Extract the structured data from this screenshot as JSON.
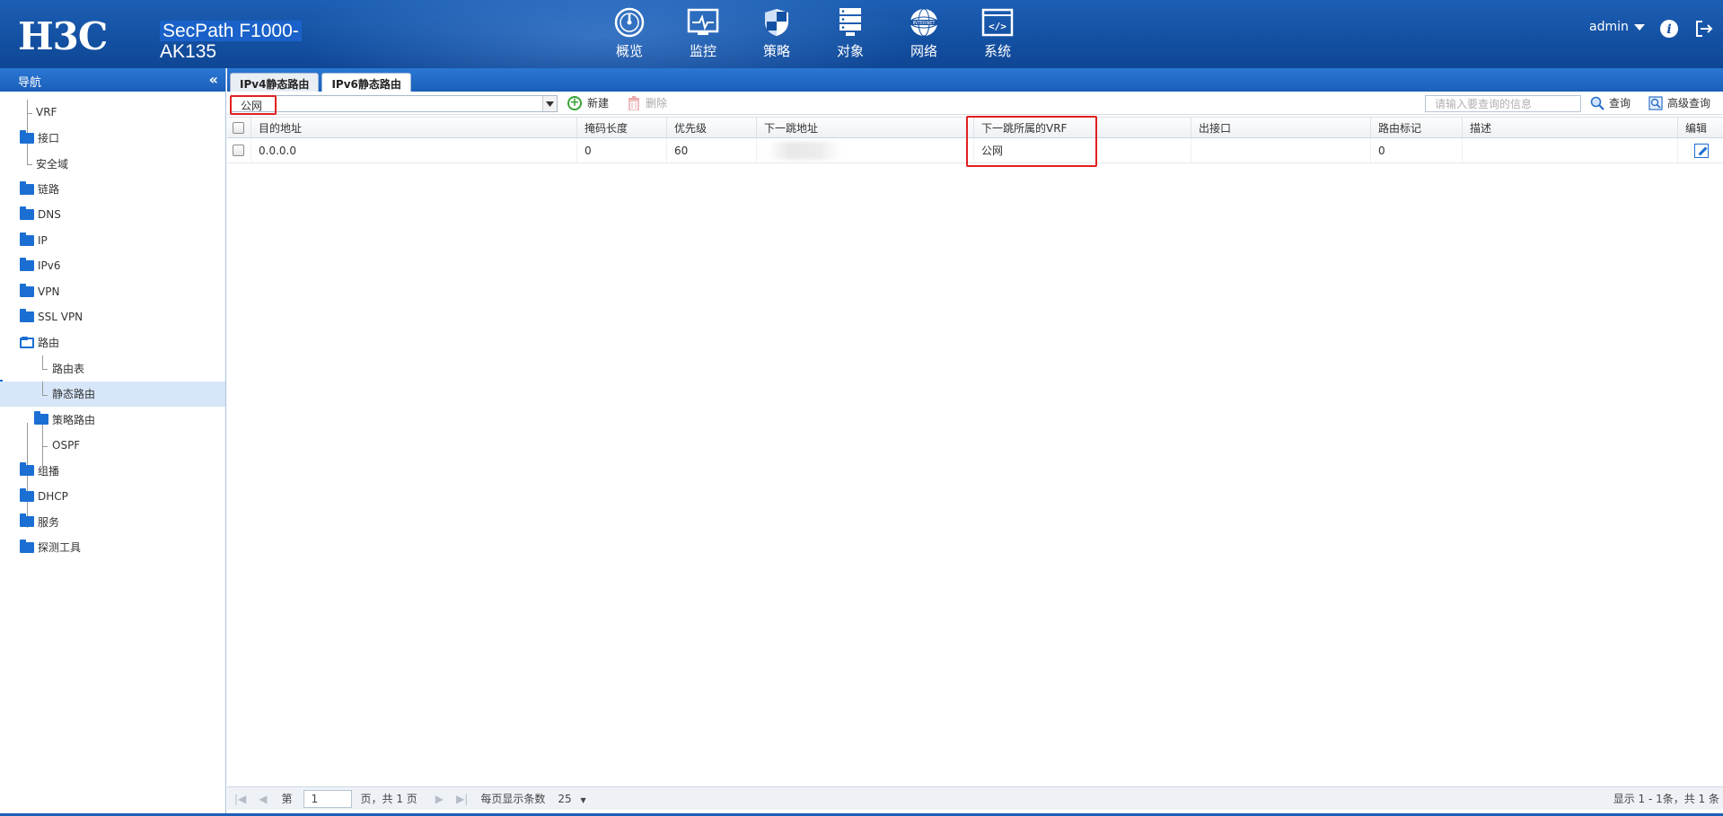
{
  "header": {
    "logo": "H3C",
    "product_line1": "SecPath F1000-",
    "product_line2": "AK135",
    "nav": [
      {
        "label": "概览",
        "icon": "dashboard-icon"
      },
      {
        "label": "监控",
        "icon": "monitor-icon"
      },
      {
        "label": "策略",
        "icon": "shield-icon"
      },
      {
        "label": "对象",
        "icon": "server-stack-icon"
      },
      {
        "label": "网络",
        "icon": "globe-internet-icon"
      },
      {
        "label": "系统",
        "icon": "code-window-icon"
      }
    ],
    "user": "admin"
  },
  "sidebar": {
    "title": "导航",
    "items": [
      {
        "label": "VRF"
      },
      {
        "label": "接口"
      },
      {
        "label": "安全域"
      },
      {
        "label": "链路"
      },
      {
        "label": "DNS"
      },
      {
        "label": "IP"
      },
      {
        "label": "IPv6"
      },
      {
        "label": "VPN"
      },
      {
        "label": "SSL VPN"
      },
      {
        "label": "路由"
      },
      {
        "label": "路由表"
      },
      {
        "label": "静态路由"
      },
      {
        "label": "策略路由"
      },
      {
        "label": "OSPF"
      },
      {
        "label": "组播"
      },
      {
        "label": "DHCP"
      },
      {
        "label": "服务"
      },
      {
        "label": "探测工具"
      }
    ]
  },
  "tabs": [
    {
      "label": "IPv4静态路由",
      "active": false
    },
    {
      "label": "IPv6静态路由",
      "active": true
    }
  ],
  "toolbar": {
    "vrf_value": "公网",
    "new_label": "新建",
    "delete_label": "删除",
    "search_placeholder": "请输入要查询的信息",
    "query_label": "查询",
    "advanced_query_label": "高级查询"
  },
  "table": {
    "columns": [
      "目的地址",
      "掩码长度",
      "优先级",
      "下一跳地址",
      "下一跳所属的VRF",
      "出接口",
      "路由标记",
      "描述",
      "编辑"
    ],
    "rows": [
      {
        "dest": "0.0.0.0",
        "mask": "0",
        "priority": "60",
        "nexthop": "",
        "vrf": "公网",
        "iface": "",
        "tag": "0",
        "desc": ""
      }
    ]
  },
  "pager": {
    "page_prefix": "第",
    "page_value": "1",
    "page_suffix": "页，共 1 页",
    "per_page_label": "每页显示条数",
    "per_page_value": "25",
    "summary": "显示 1 - 1条，共 1 条"
  },
  "colors": {
    "brand_blue": "#1b5fb8",
    "highlight_red": "#e02020",
    "selected_row": "#d7e6f8"
  }
}
